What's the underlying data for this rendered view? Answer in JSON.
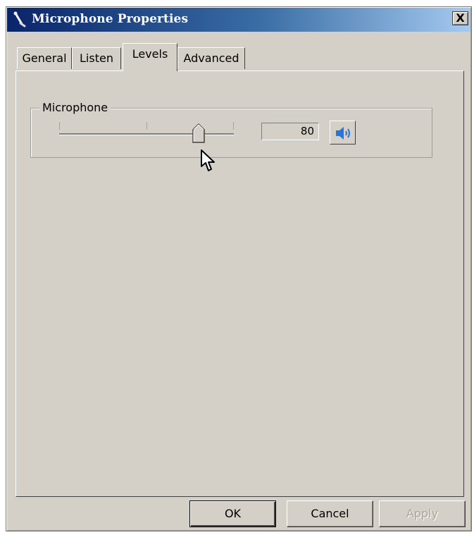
{
  "window": {
    "title": "Microphone Properties",
    "title_icon": "microphone-icon",
    "close_label": "X"
  },
  "tabs": [
    {
      "label": "General",
      "active": false
    },
    {
      "label": "Listen",
      "active": false
    },
    {
      "label": "Levels",
      "active": true
    },
    {
      "label": "Advanced",
      "active": false
    }
  ],
  "levels": {
    "group_label": "Microphone",
    "slider_value": 80,
    "slider_range": [
      0,
      100
    ],
    "value_text": "80",
    "mute_icon": "speaker-icon",
    "cursor_icon": "mouse-pointer-icon"
  },
  "buttons": {
    "ok": "OK",
    "cancel": "Cancel",
    "apply": "Apply"
  },
  "colors": {
    "dialog_face": "#d4d0c8",
    "titlebar_start": "#0a246a",
    "titlebar_end": "#a6caf0",
    "speaker_blue": "#2b74d9",
    "disabled_text": "#a9a59b"
  }
}
